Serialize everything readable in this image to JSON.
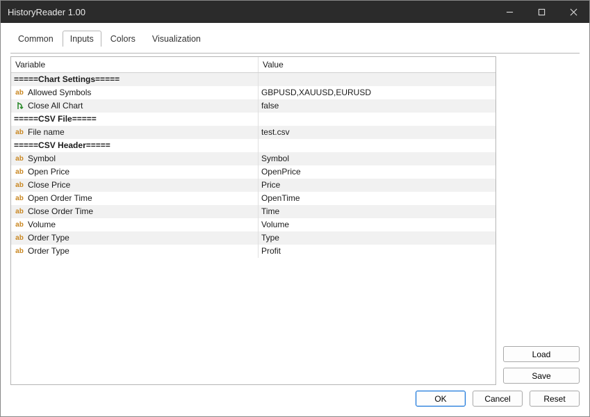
{
  "window": {
    "title": "HistoryReader 1.00"
  },
  "tabs": [
    "Common",
    "Inputs",
    "Colors",
    "Visualization"
  ],
  "activeTab": 1,
  "columns": {
    "variable": "Variable",
    "value": "Value"
  },
  "rows": [
    {
      "kind": "section",
      "variable": "=====Chart Settings=====",
      "value": ""
    },
    {
      "kind": "ab",
      "variable": "Allowed Symbols",
      "value": "GBPUSD,XAUUSD,EURUSD"
    },
    {
      "kind": "bool",
      "variable": "Close All Chart",
      "value": "false"
    },
    {
      "kind": "section",
      "variable": "=====CSV File=====",
      "value": ""
    },
    {
      "kind": "ab",
      "variable": "File name",
      "value": "test.csv"
    },
    {
      "kind": "section",
      "variable": "=====CSV Header=====",
      "value": ""
    },
    {
      "kind": "ab",
      "variable": "Symbol",
      "value": "Symbol"
    },
    {
      "kind": "ab",
      "variable": "Open Price",
      "value": "OpenPrice"
    },
    {
      "kind": "ab",
      "variable": "Close Price",
      "value": "Price"
    },
    {
      "kind": "ab",
      "variable": "Open Order Time",
      "value": "OpenTime"
    },
    {
      "kind": "ab",
      "variable": "Close Order Time",
      "value": "Time"
    },
    {
      "kind": "ab",
      "variable": "Volume",
      "value": "Volume"
    },
    {
      "kind": "ab",
      "variable": "Order Type",
      "value": "Type"
    },
    {
      "kind": "ab",
      "variable": "Order Type",
      "value": "Profit"
    }
  ],
  "buttons": {
    "load": "Load",
    "save": "Save",
    "ok": "OK",
    "cancel": "Cancel",
    "reset": "Reset"
  }
}
